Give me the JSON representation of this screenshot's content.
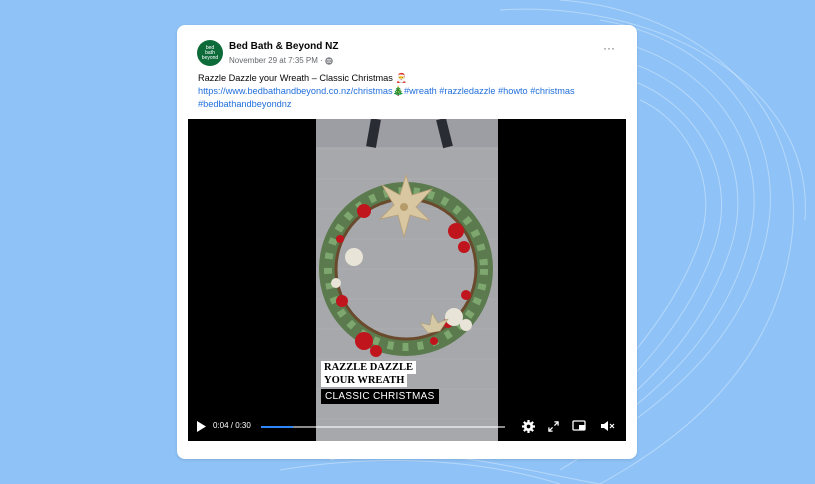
{
  "post": {
    "page_name": "Bed Bath & Beyond NZ",
    "avatar_text": [
      "bed",
      "bath",
      "beyond"
    ],
    "timestamp": "November 29 at 7:35 PM",
    "separator": "·",
    "title": "Razzle Dazzle your Wreath – Classic Christmas",
    "title_emoji": "🎅",
    "link": "https://www.bedbathandbeyond.co.nz/christmas",
    "tree_emoji": "🎄",
    "hashtags_line1": "#wreath #razzledazzle #howto #christmas",
    "hashtags_line2": "#bedbathandbeyondnz",
    "more_label": "···"
  },
  "video": {
    "caption_line1": "RAZZLE DAZZLE",
    "caption_line2": "YOUR WREATH",
    "caption_line3": "CLASSIC CHRISTMAS",
    "time": "0:04 / 0:30",
    "progress_fraction": 0.13,
    "icons": [
      "play-icon",
      "settings-icon",
      "fullscreen-icon",
      "picture-in-picture-icon",
      "volume-muted-icon"
    ]
  },
  "colors": {
    "background": "#8fc3f7",
    "link": "#216fdb",
    "avatar": "#0d6b3a",
    "progress": "#2d88ff"
  }
}
